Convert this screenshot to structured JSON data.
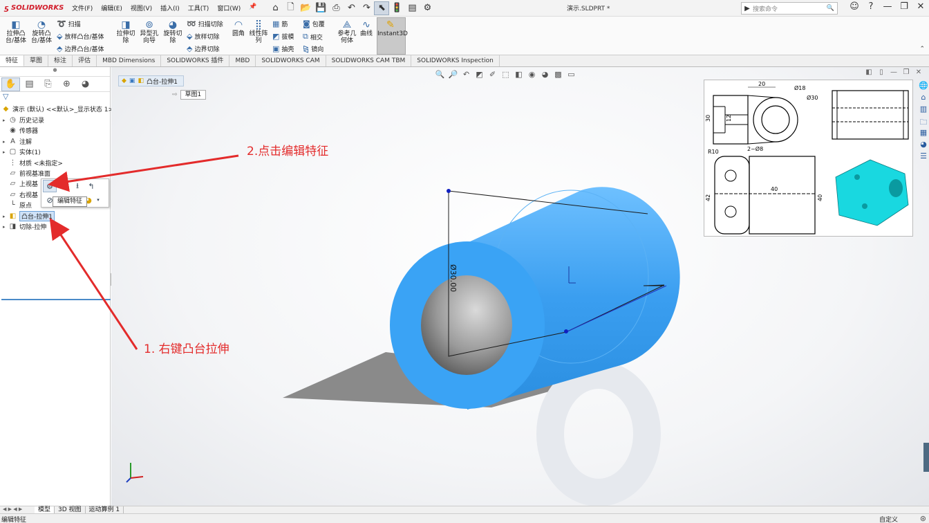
{
  "app": {
    "logo_text": "SOLIDWORKS",
    "document_title": "演示.SLDPRT *",
    "menus": [
      "文件(F)",
      "编辑(E)",
      "视图(V)",
      "插入(I)",
      "工具(T)",
      "窗口(W)"
    ],
    "search_placeholder": "搜索命令"
  },
  "commands": {
    "extrude_boss": "拉伸凸\n台/基体",
    "revolve_boss": "旋转凸\n台/基体",
    "sweep": "扫描",
    "loft": "放样凸台/基体",
    "boundary_boss": "边界凸台/基体",
    "extrude_cut": "拉伸切\n除",
    "hole_wizard": "异型孔\n向导",
    "revolve_cut": "旋转切\n除",
    "swept_cut": "扫描切除",
    "lofted_cut": "放样切除",
    "boundary_cut": "边界切除",
    "fillet": "圆角",
    "linear_pattern": "线性阵\n列",
    "rib": "筋",
    "draft": "拔模",
    "shell": "抽壳",
    "wrap": "包覆",
    "intersect": "相交",
    "mirror": "镜向",
    "ref_geometry": "参考几\n何体",
    "curves": "曲线",
    "instant3d": "Instant3D"
  },
  "tabs": [
    "特征",
    "草图",
    "标注",
    "评估",
    "MBD Dimensions",
    "SOLIDWORKS 插件",
    "MBD",
    "SOLIDWORKS CAM",
    "SOLIDWORKS CAM TBM",
    "SOLIDWORKS Inspection"
  ],
  "tree": {
    "root": "演示 (默认) <<默认>_显示状态 1>",
    "items": [
      {
        "label": "历史记录",
        "icon": "history-icon"
      },
      {
        "label": "传感器",
        "icon": "sensor-icon"
      },
      {
        "label": "注解",
        "icon": "annotation-icon"
      },
      {
        "label": "实体(1)",
        "icon": "solid-bodies-icon"
      },
      {
        "label": "材质 <未指定>",
        "icon": "material-icon"
      },
      {
        "label": "前视基准面",
        "icon": "plane-icon"
      },
      {
        "label": "上视基",
        "icon": "plane-icon"
      },
      {
        "label": "右视基",
        "icon": "plane-icon"
      },
      {
        "label": "原点",
        "icon": "origin-icon"
      },
      {
        "label": "凸台-拉伸1",
        "icon": "extrude-icon"
      },
      {
        "label": "切除-拉伸",
        "icon": "cut-extrude-icon"
      }
    ]
  },
  "context_menu": {
    "tooltip": "编辑特征"
  },
  "viewport": {
    "breadcrumb_feature": "凸台-拉伸1",
    "breadcrumb_sketch": "草图1",
    "dimension_label": "Ø30.00"
  },
  "refdrawing": {
    "dim_20": "20",
    "dim_d18": "Ø18",
    "dim_d30": "Ø30",
    "dim_30": "30",
    "dim_12": "12",
    "dim_r10": "R10",
    "dim_2xd8": "2~Ø8",
    "dim_40": "40",
    "dim_42": "42",
    "dim_40b": "40"
  },
  "annotations": {
    "step1": "1. 右键凸台拉伸",
    "step2": "2.点击编辑特征"
  },
  "bottom_tabs": [
    "模型",
    "3D 视图",
    "运动算例 1"
  ],
  "status": {
    "text": "编辑特征",
    "custom": "自定义"
  },
  "colors": {
    "annotation_red": "#e32b2b",
    "part_blue": "#3a9ef0",
    "solidworks_red": "#d21d2b"
  }
}
